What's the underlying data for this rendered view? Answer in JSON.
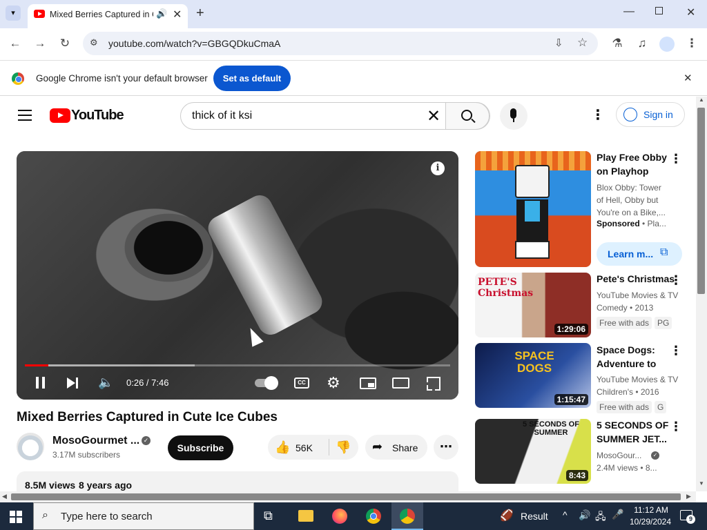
{
  "browser": {
    "tab_title": "Mixed Berries Captured in Cute Ice Cubes - YouTube",
    "url": "youtube.com/watch?v=GBGQDkuCmaA",
    "infobar_text": "Google Chrome isn't your default browser",
    "infobar_button": "Set as default"
  },
  "youtube": {
    "logo_text": "YouTube",
    "search_value": "thick of it ksi",
    "sign_in": "Sign in"
  },
  "player": {
    "time": "0:26 / 7:46",
    "played_fraction": 0.056,
    "buffered_fraction": 0.4
  },
  "video": {
    "title": "Mixed Berries Captured in Cute Ice Cubes",
    "channel": "MosoGourmet ...",
    "subscribers": "3.17M subscribers",
    "subscribe": "Subscribe",
    "likes": "56K",
    "share": "Share",
    "views": "8.5M views",
    "age": "8 years ago"
  },
  "sidebar": {
    "ad": {
      "title": "Play Free Obby on Playhop",
      "desc": "Blox Obby: Tower of Hell, Obby but You're on a Bike,...",
      "sponsored": "Sponsored",
      "sponsor_tail": "• Pla...",
      "cta": "Learn m..."
    },
    "items": [
      {
        "title": "Pete's Christmas",
        "meta1": "YouTube Movies & TV",
        "meta2": "Comedy • 2013",
        "badge": "Free with ads",
        "rating": "PG",
        "duration": "1:29:06",
        "thumb_text": "PETE'S Christmas"
      },
      {
        "title": "Space Dogs: Adventure to the...",
        "meta1": "YouTube Movies & TV",
        "meta2": "Children's • 2016",
        "badge": "Free with ads",
        "rating": "G",
        "duration": "1:15:47",
        "thumb_text": "SPACE DOGS"
      },
      {
        "title": "5 SECONDS OF SUMMER JET...",
        "meta1": "MosoGour...",
        "meta2": "2.4M views • 8...",
        "duration": "8:43",
        "thumb_text": "5 SECONDS OF SUMMER"
      }
    ]
  },
  "taskbar": {
    "search_placeholder": "Type here to search",
    "weather": "Result",
    "time": "11:12 AM",
    "date": "10/29/2024",
    "notifications": "9"
  },
  "colors": {
    "accent": "#ff0000",
    "link": "#065fd4",
    "chrome_blue": "#0b57d0"
  }
}
